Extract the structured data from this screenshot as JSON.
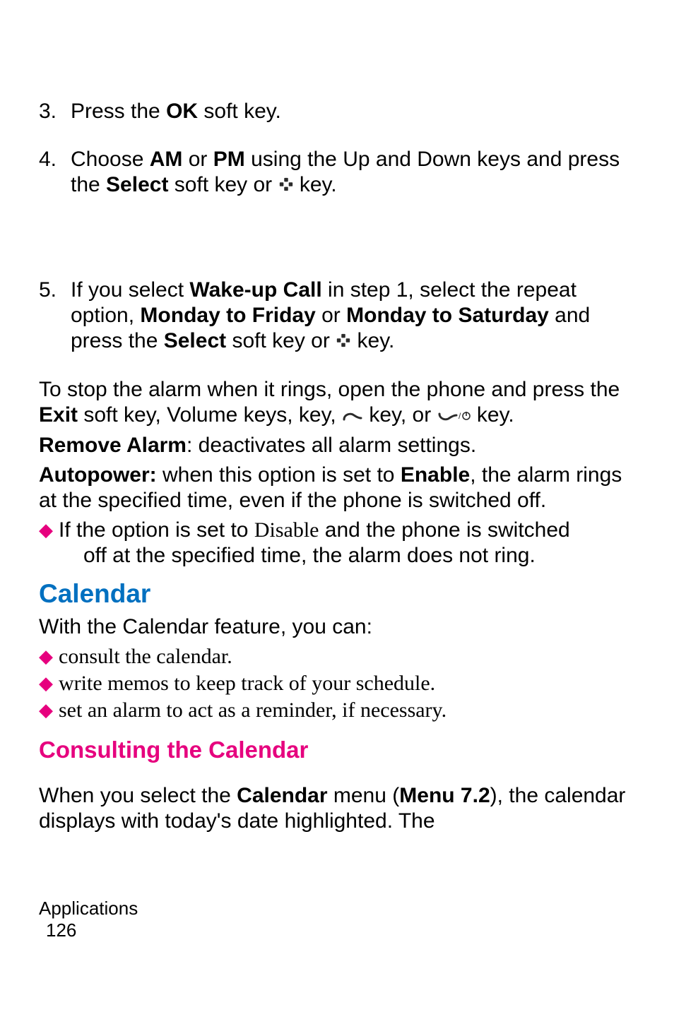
{
  "steps": {
    "s3": {
      "num": "3.",
      "t1": "Press the ",
      "b1": "OK",
      "t2": " soft key."
    },
    "s4": {
      "num": "4.",
      "t1": "Choose ",
      "b1": "AM",
      "t2": " or ",
      "b2": "PM",
      "t3": " using the Up and Down keys and press the ",
      "b3": "Select",
      "t4": " soft key or ",
      "t5": " key."
    },
    "s5": {
      "num": "5.",
      "t1": "If you select ",
      "b1": "Wake-up Call",
      "t2": " in step 1, select the repeat option, ",
      "b2": "Monday to Friday",
      "t3": " or ",
      "b3": "Monday to Saturday",
      "t4": " and press the ",
      "b4": "Select",
      "t5": " soft key or ",
      "t6": " key."
    }
  },
  "stopAlarm": {
    "t1": "To stop the alarm when it rings, open the phone and press the ",
    "b1": "Exit",
    "t2": " soft key, Volume keys,    key,  ",
    "t3": " key, or ",
    "t4": " key."
  },
  "removeAlarm": {
    "b1": "Remove Alarm",
    "t1": ": deactivates all alarm settings."
  },
  "autopower": {
    "b1": "Autopower:",
    "t1": " when this option is set to ",
    "b2": "Enable",
    "t2": ", the alarm rings at the specified time, even if the phone is switched off."
  },
  "disableNote": {
    "t1": "If the option is set to ",
    "s1": "Disable",
    "t2": " and the phone is switched ",
    "t3": "off at the specified time, the alarm does not ring."
  },
  "calendar": {
    "heading": "Calendar",
    "intro": "With the Calendar feature, you can:",
    "bullets": {
      "b1": "consult the calendar.",
      "b2": "write memos to keep track of your schedule.",
      "b3": "set an alarm to act as a reminder, if necessary."
    },
    "consultHeading": "Consulting the Calendar",
    "consultText": {
      "t1": "When you select the ",
      "b1": "Calendar",
      "t2": " menu (",
      "b2": "Menu 7.2",
      "t3": "), the calendar displays with today's date highlighted. The "
    }
  },
  "footer": {
    "section": "Applications",
    "page": "126"
  },
  "iconNames": {
    "dpad": "dpad-icon",
    "send": "send-key-icon",
    "end": "end-power-key-icon"
  }
}
